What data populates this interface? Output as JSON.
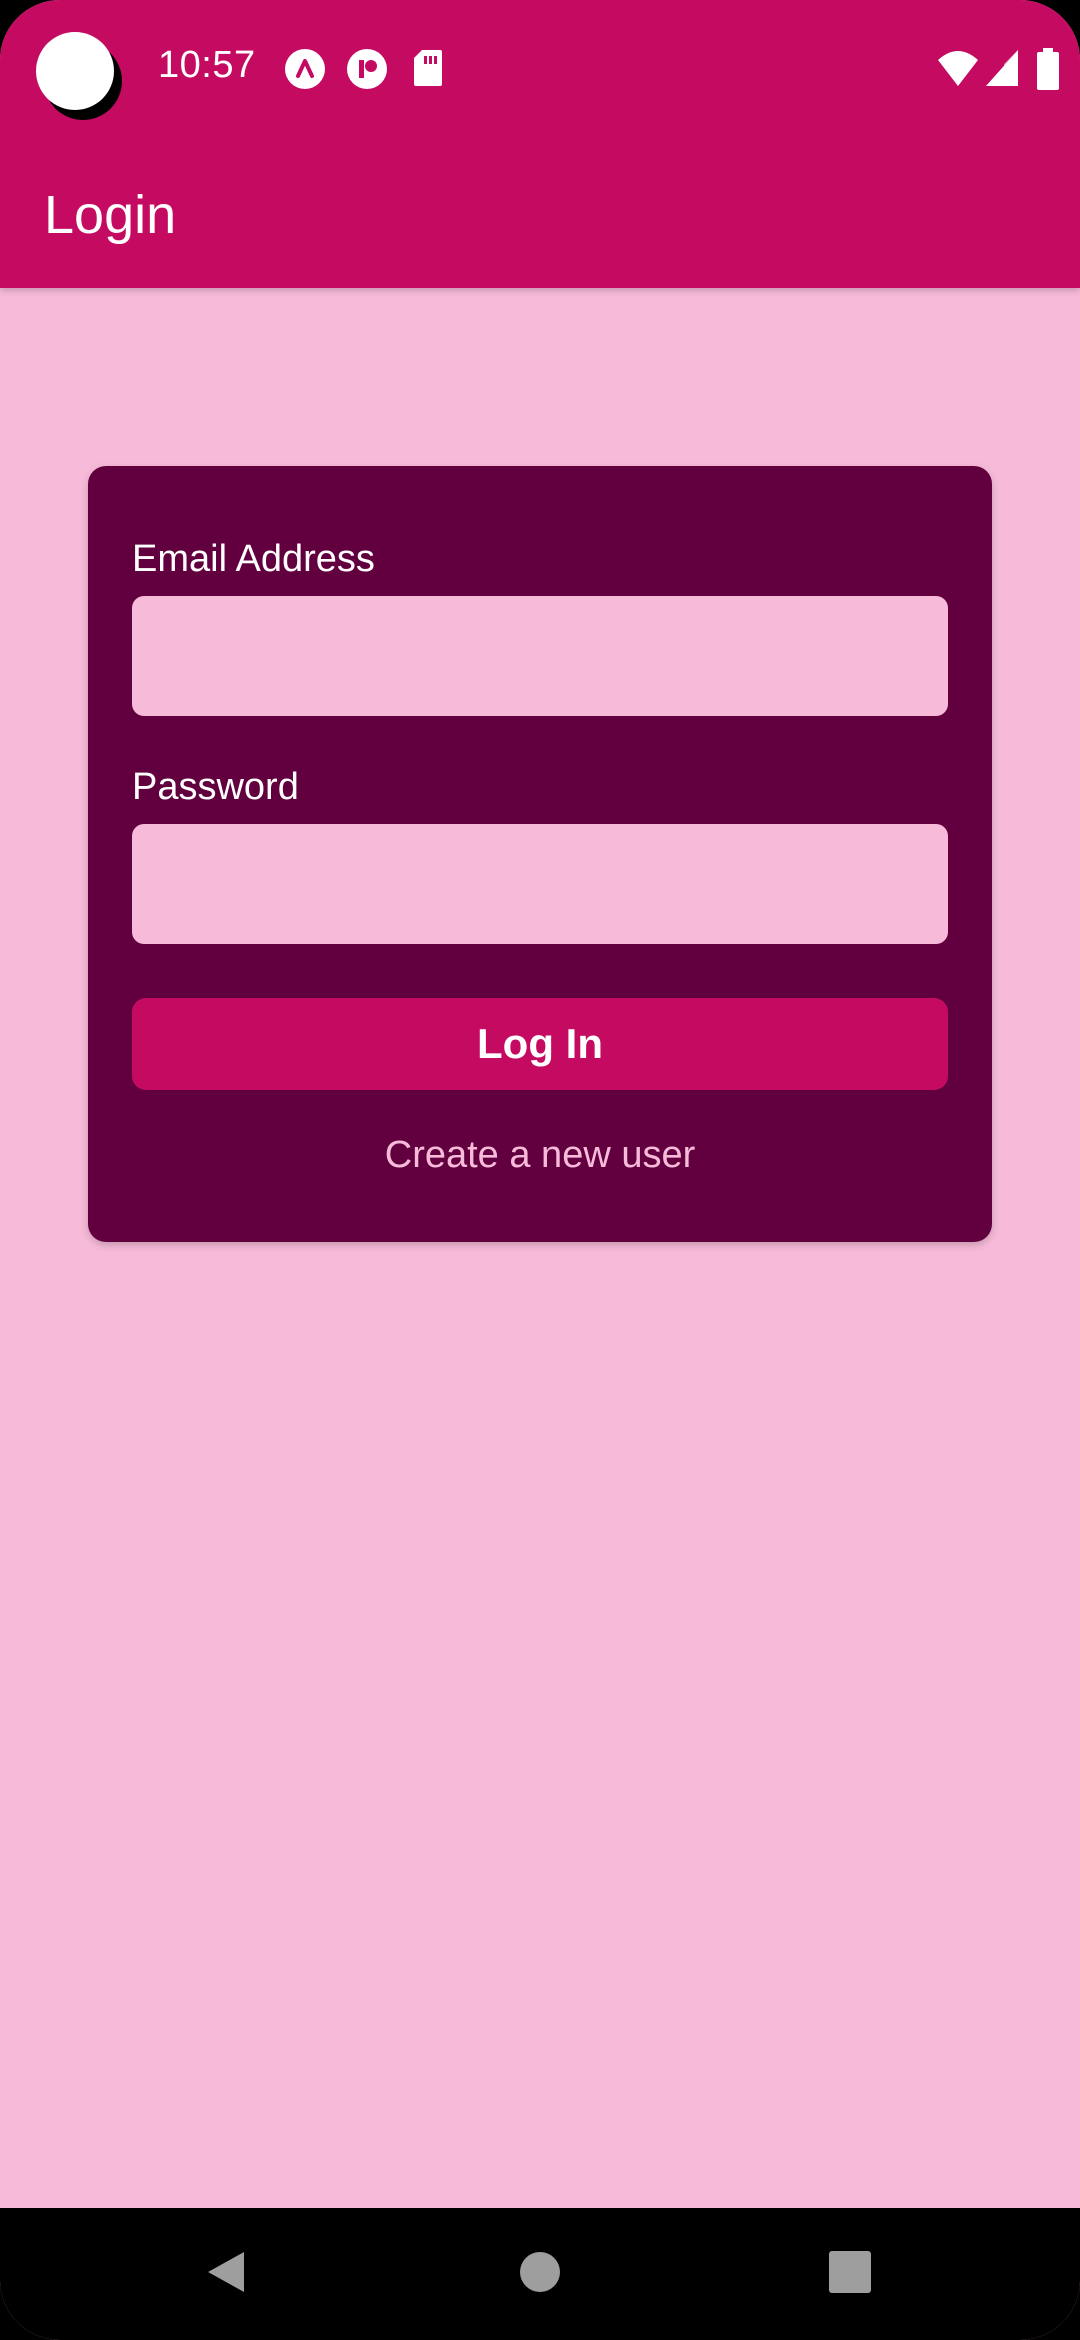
{
  "status_bar": {
    "time": "10:57",
    "icons_left": [
      "app-a-icon",
      "app-p-icon",
      "sd-card-icon"
    ],
    "icons_right": [
      "wifi-icon",
      "cell-signal-icon",
      "battery-icon"
    ]
  },
  "app_bar": {
    "title": "Login"
  },
  "login_form": {
    "email_label": "Email Address",
    "email_value": "",
    "password_label": "Password",
    "password_value": "",
    "login_button_label": "Log In",
    "create_user_link": "Create a new user"
  },
  "nav_bar": {
    "buttons": [
      "back-icon",
      "home-icon",
      "recents-icon"
    ]
  },
  "colors": {
    "primary": "#C40A61",
    "card": "#62003F",
    "background": "#F7BBD9",
    "text_on_primary": "#FFFFFF"
  }
}
